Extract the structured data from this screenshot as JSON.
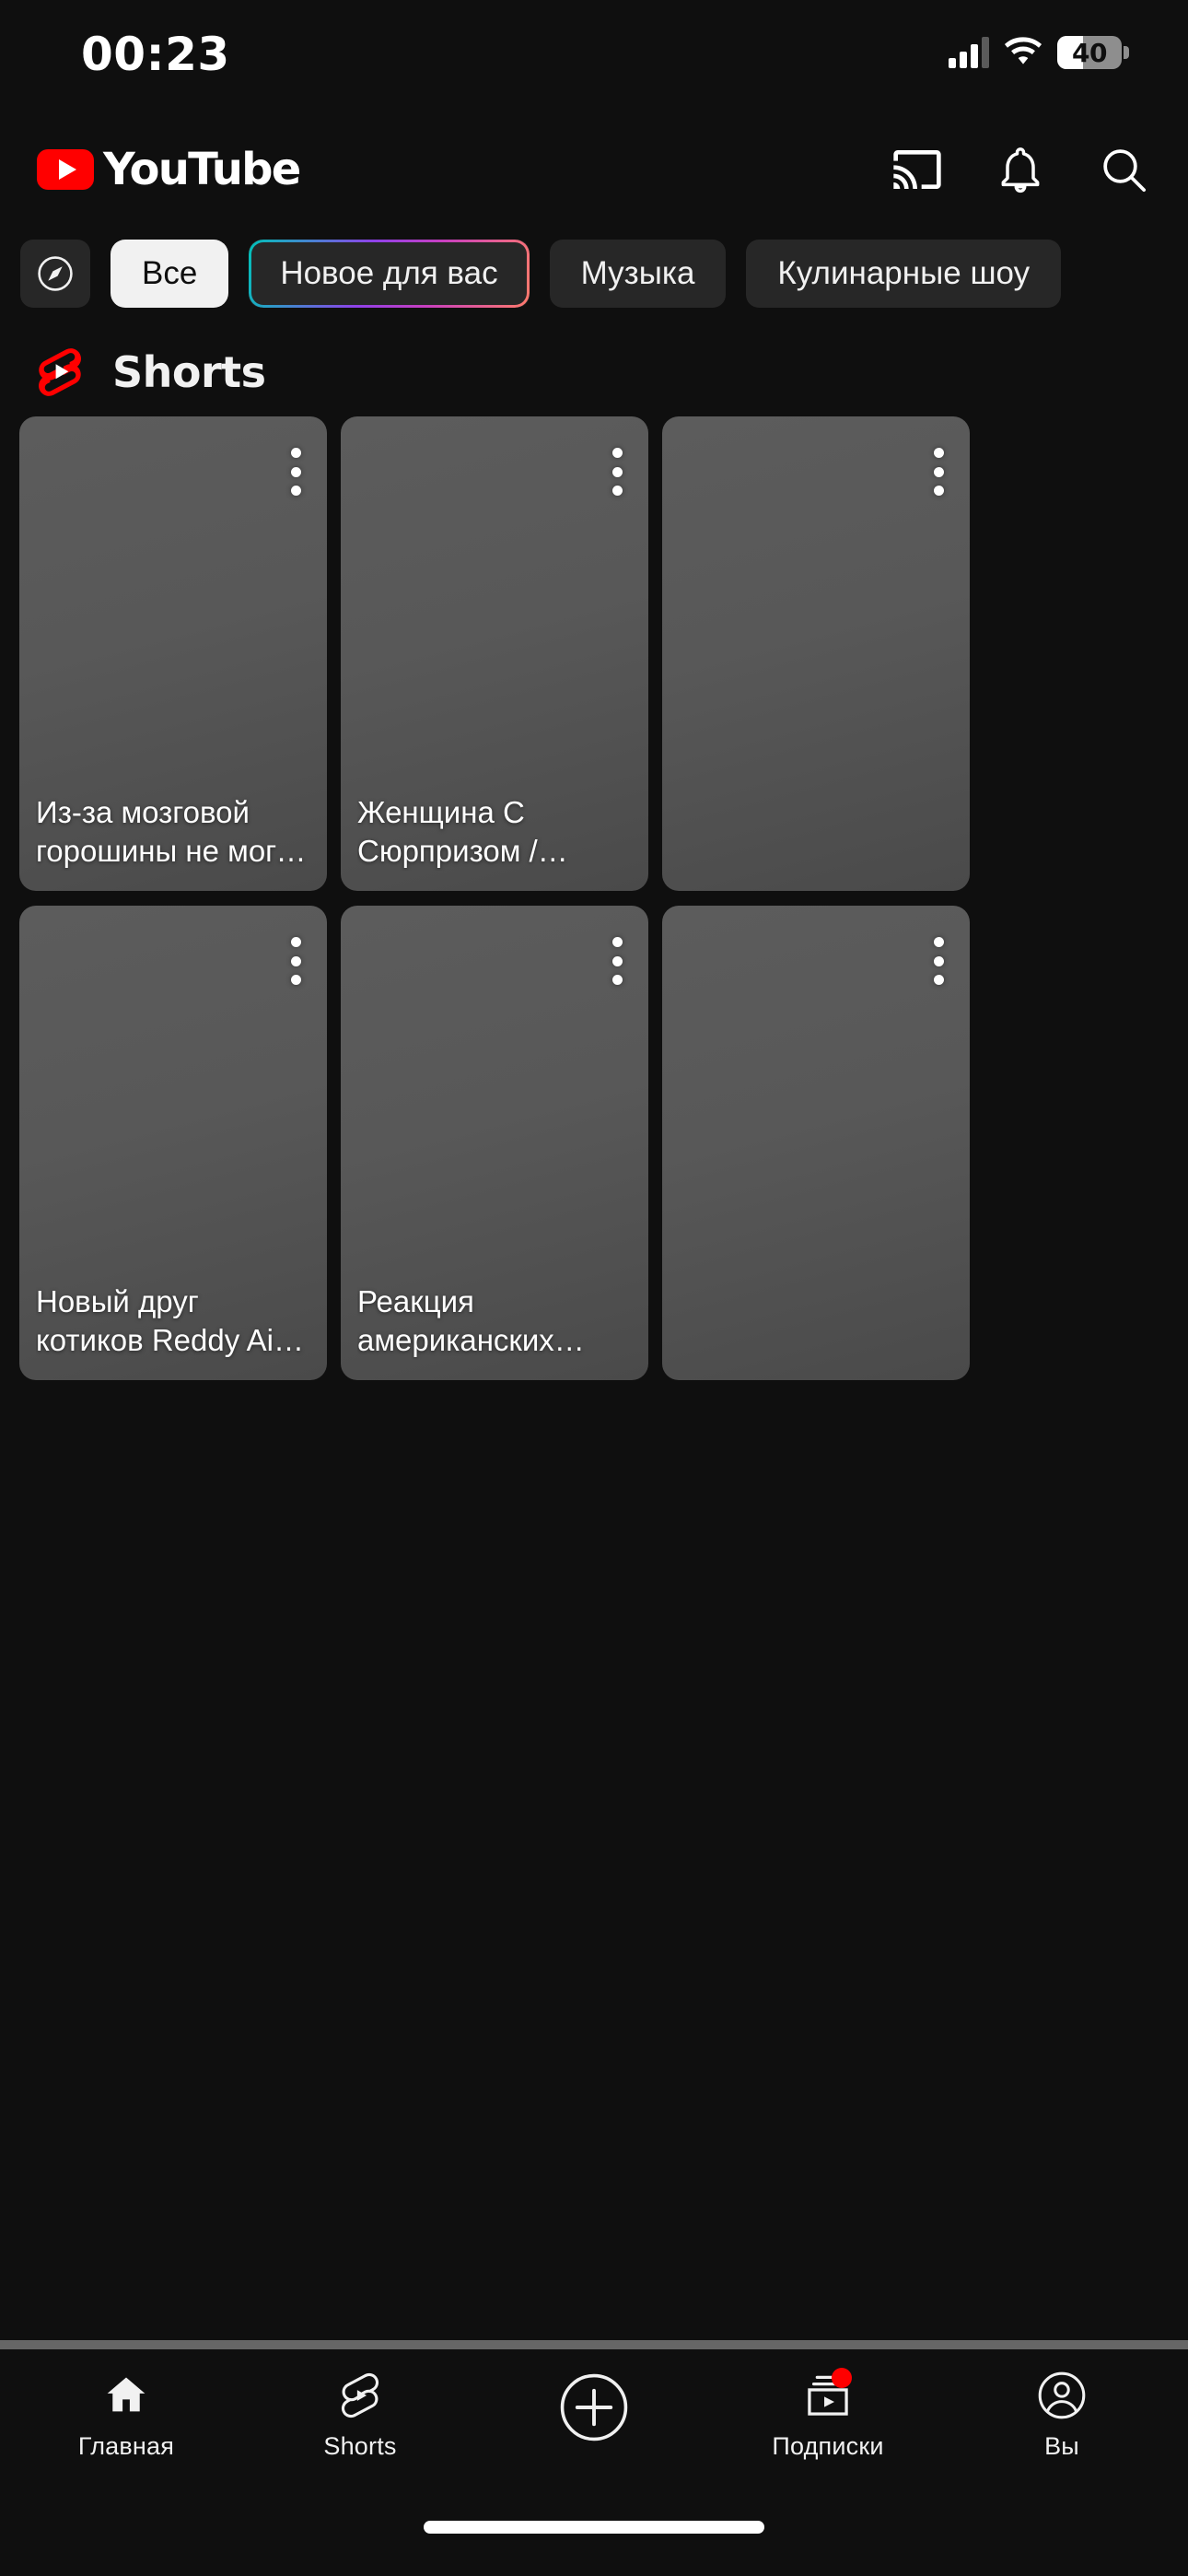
{
  "status_bar": {
    "time": "00:23",
    "battery_level": "40",
    "battery_percent": 40,
    "signal_bars_active": 3,
    "signal_bars_total": 4,
    "wifi_icon": "wifi-icon",
    "cellular_icon": "cellular-signal-icon",
    "battery_icon": "battery-icon"
  },
  "header": {
    "logo_text": "YouTube",
    "logo_icon": "youtube-play-logo",
    "brand_color": "#ff0000",
    "actions": [
      {
        "name": "cast-icon",
        "label": "Трансляция"
      },
      {
        "name": "bell-icon",
        "label": "Уведомления"
      },
      {
        "name": "search-icon",
        "label": "Поиск"
      }
    ]
  },
  "chips": [
    {
      "label": "",
      "icon": "compass-explore-icon",
      "style": "icon",
      "selected": false
    },
    {
      "label": "Все",
      "icon": "",
      "style": "active",
      "selected": true
    },
    {
      "label": "Новое для вас",
      "icon": "",
      "style": "gradient",
      "selected": false
    },
    {
      "label": "Музыка",
      "icon": "",
      "style": "default",
      "selected": false
    },
    {
      "label": "Кулинарные шоу",
      "icon": "",
      "style": "default",
      "selected": false
    }
  ],
  "shorts_section": {
    "title": "Shorts",
    "logo_icon": "shorts-logo-icon",
    "logo_color": "#ff0000",
    "cards": [
      {
        "title": "Из-за мозговой горошины не могла усн…",
        "menu_icon": "more-vertical-icon"
      },
      {
        "title": "Женщина С Сюрпризом / Жидковский #интервь…",
        "menu_icon": "more-vertical-icon"
      },
      {
        "title": "",
        "menu_icon": "more-vertical-icon"
      },
      {
        "title": "Новый друг котиков Reddy Air ❤️",
        "menu_icon": "more-vertical-icon"
      },
      {
        "title": "Реакция американских булли на кота",
        "menu_icon": "more-vertical-icon"
      },
      {
        "title": "",
        "menu_icon": "more-vertical-icon"
      }
    ]
  },
  "bottom_nav": {
    "items": [
      {
        "label": "Главная",
        "icon": "home-icon",
        "active": true,
        "badge": false
      },
      {
        "label": "Shorts",
        "icon": "shorts-outline-icon",
        "active": false,
        "badge": false
      },
      {
        "label": "",
        "icon": "plus-circle-icon",
        "active": false,
        "badge": false
      },
      {
        "label": "Подписки",
        "icon": "subscriptions-icon",
        "active": false,
        "badge": true
      },
      {
        "label": "Вы",
        "icon": "account-circle-icon",
        "active": false,
        "badge": false
      }
    ],
    "badge_color": "#ff0000"
  }
}
